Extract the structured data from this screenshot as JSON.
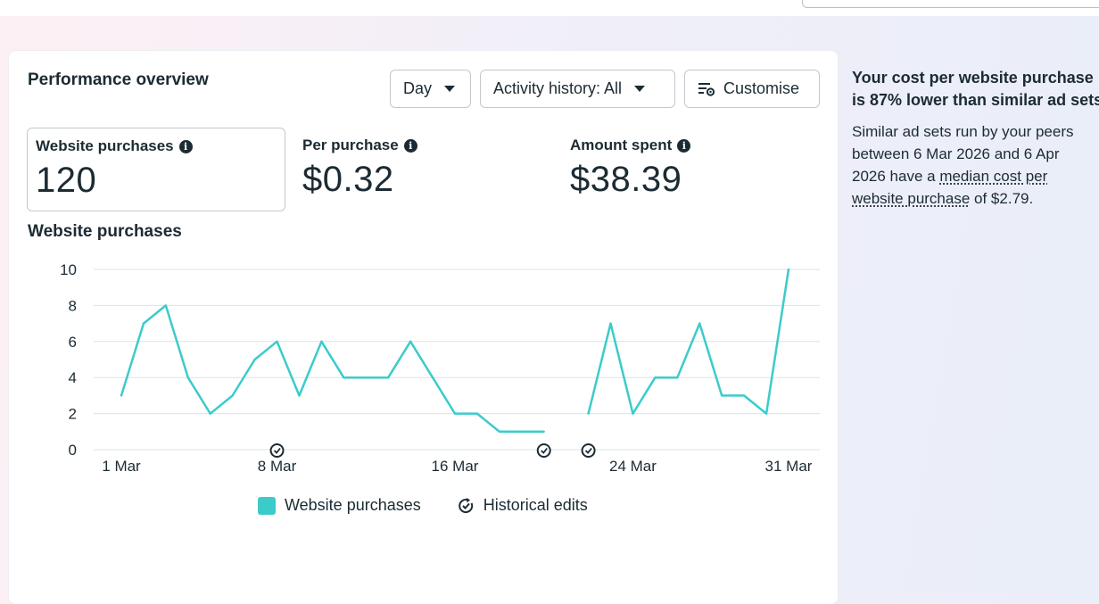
{
  "header": {
    "search_placeholder": ""
  },
  "card": {
    "title": "Performance overview",
    "controls": {
      "day_label": "Day",
      "activity_label": "Activity history: All",
      "customise_label": "Customise"
    },
    "metrics": [
      {
        "label": "Website purchases",
        "value": "120",
        "selected": true
      },
      {
        "label": "Per purchase",
        "value": "$0.32",
        "selected": false
      },
      {
        "label": "Amount spent",
        "value": "$38.39",
        "selected": false
      }
    ],
    "chart_title": "Website purchases",
    "legend": {
      "series_label": "Website purchases",
      "edits_label": "Historical edits"
    }
  },
  "insight": {
    "headline_1": "Your cost per website purchase",
    "headline_2": "is 87% lower than similar ad sets",
    "body_1": "Similar ad sets run by your peers between 6 Mar 2026 and 6 Apr 2026 have a ",
    "body_link": "median cost per website purchase",
    "body_2": " of $2.79."
  },
  "colors": {
    "series": "#3ccbcb",
    "grid": "#dfe1e4",
    "text": "#1c2b33"
  },
  "icons": [
    "info-icon",
    "chevron-down-icon",
    "customise-icon",
    "historical-edit-icon"
  ],
  "chart_data": {
    "type": "line",
    "title": "Website purchases",
    "x": [
      "1 Mar",
      "2 Mar",
      "3 Mar",
      "4 Mar",
      "5 Mar",
      "6 Mar",
      "7 Mar",
      "8 Mar",
      "9 Mar",
      "10 Mar",
      "11 Mar",
      "12 Mar",
      "13 Mar",
      "14 Mar",
      "15 Mar",
      "16 Mar",
      "17 Mar",
      "18 Mar",
      "19 Mar",
      "20 Mar",
      "21 Mar",
      "22 Mar",
      "23 Mar",
      "24 Mar",
      "25 Mar",
      "26 Mar",
      "27 Mar",
      "28 Mar",
      "29 Mar",
      "30 Mar",
      "31 Mar"
    ],
    "x_tick_labels": [
      "1 Mar",
      "8 Mar",
      "16 Mar",
      "24 Mar",
      "31 Mar"
    ],
    "series": [
      {
        "name": "Website purchases",
        "values": [
          3,
          7,
          8,
          4,
          2,
          3,
          5,
          6,
          3,
          6,
          4,
          4,
          4,
          6,
          4,
          2,
          2,
          1,
          1,
          1,
          null,
          2,
          7,
          2,
          4,
          4,
          7,
          3,
          3,
          2,
          10
        ]
      }
    ],
    "ylim": [
      0,
      10
    ],
    "y_ticks": [
      0,
      2,
      4,
      6,
      8,
      10
    ],
    "grid": true,
    "legend_position": "bottom",
    "historical_edits": [
      "8 Mar",
      "20 Mar",
      "22 Mar"
    ]
  }
}
